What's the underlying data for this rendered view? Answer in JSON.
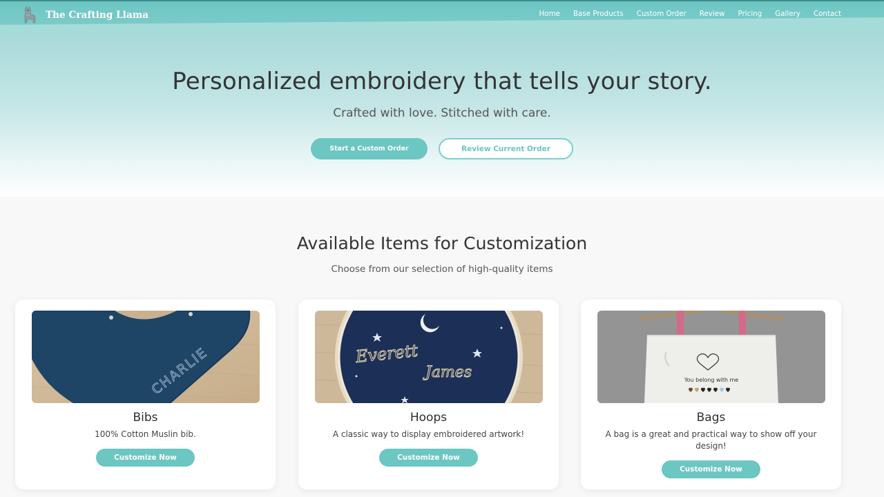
{
  "header": {
    "brand": "The Crafting Llama",
    "logo_icon": "llama-icon",
    "nav": [
      "Home",
      "Base Products",
      "Custom Order",
      "Review",
      "Pricing",
      "Gallery",
      "Contact"
    ]
  },
  "hero": {
    "title": "Personalized embroidery that tells your story.",
    "subtitle": "Crafted with love. Stitched with care.",
    "primary_button": "Start a Custom Order",
    "secondary_button": "Review Current Order"
  },
  "products": {
    "title": "Available Items for Customization",
    "subtitle": "Choose from our selection of high-quality items",
    "items": [
      {
        "name": "Bibs",
        "description": "100% Cotton Muslin bib.",
        "button": "Customize Now",
        "image_text": "CHARLIE"
      },
      {
        "name": "Hoops",
        "description": "A classic way to display embroidered artwork!",
        "button": "Customize Now",
        "image_text_line1": "Everett",
        "image_text_line2": "James"
      },
      {
        "name": "Bags",
        "description": "A bag is a great and practical way to show off your design!",
        "button": "Customize Now",
        "image_text": "You belong with me"
      }
    ]
  },
  "colors": {
    "accent": "#6cc6c2",
    "header": "#7ccbc8",
    "text_dark": "#343434"
  }
}
